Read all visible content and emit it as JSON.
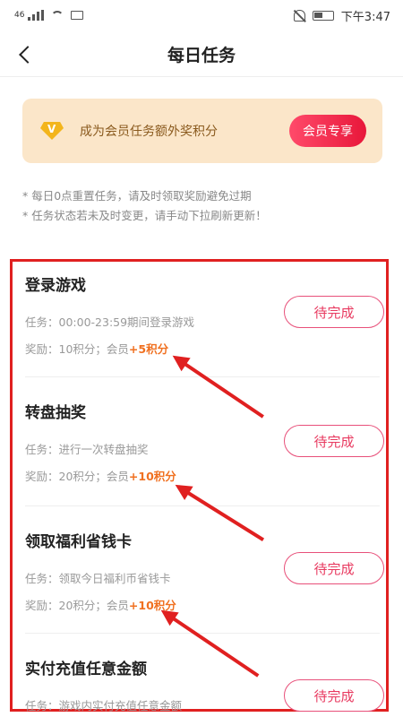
{
  "status_bar": {
    "left_text": "46",
    "time": "下午3:47",
    "icons": [
      "signal-icon",
      "wifi-icon",
      "mail-icon",
      "bell-mute-icon",
      "battery-icon"
    ]
  },
  "nav": {
    "title": "每日任务",
    "back_icon": "chevron-left-icon"
  },
  "vip_banner": {
    "icon": "vip-badge-icon",
    "icon_letter": "V",
    "text": "成为会员任务额外奖积分",
    "button": "会员专享",
    "colors": {
      "background": "#fbe6c9",
      "button": "#e8173a"
    }
  },
  "notes": [
    "* 每日0点重置任务，请及时领取奖励避免过期",
    "* 任务状态若未及时变更，请手动下拉刷新更新！"
  ],
  "tasks": [
    {
      "name": "登录游戏",
      "desc": "任务：00:00-23:59期间登录游戏",
      "reward": "奖励：10积分；会员",
      "bonus": "+5积分",
      "button": "待完成"
    },
    {
      "name": "转盘抽奖",
      "desc": "任务：进行一次转盘抽奖",
      "reward": "奖励：20积分；会员",
      "bonus": "+10积分",
      "button": "待完成"
    },
    {
      "name": "领取福利省钱卡",
      "desc": "任务：领取今日福利币省钱卡",
      "reward": "奖励：20积分；会员",
      "bonus": "+10积分",
      "button": "待完成"
    },
    {
      "name": "实付充值任意金额",
      "desc": "任务：游戏内实付充值任意金额",
      "button": "待完成"
    }
  ],
  "colors": {
    "highlight_box": "#e02020",
    "bonus": "#f07020",
    "task_button": "#e83a60"
  }
}
